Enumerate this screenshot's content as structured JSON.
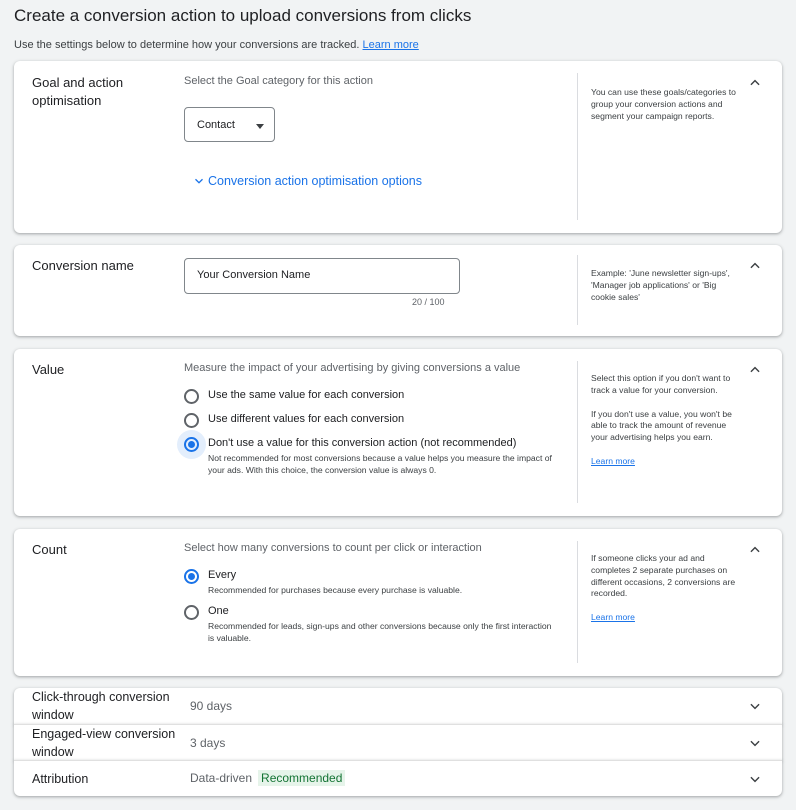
{
  "header": {
    "title": "Create a conversion action to upload conversions from clicks",
    "subtitle": "Use the settings below to determine how your conversions are tracked.",
    "learn_more": "Learn more"
  },
  "goal": {
    "title_line1": "Goal and action",
    "title_line2": "optimisation",
    "desc": "Select the Goal category for this action",
    "category_value": "Contact",
    "options_link": "Conversion action optimisation options",
    "help": "You can use these goals/categories to group your conversion actions and segment your campaign reports."
  },
  "conversion_name": {
    "title": "Conversion name",
    "value": "Your Conversion Name",
    "counter": "20 / 100",
    "help": "Example: 'June newsletter sign-ups', 'Manager job applications' or 'Big cookie sales'"
  },
  "value": {
    "title": "Value",
    "desc": "Measure the impact of your advertising by giving conversions a value",
    "options": [
      {
        "label": "Use the same value for each conversion",
        "sub": "",
        "checked": false
      },
      {
        "label": "Use different values for each conversion",
        "sub": "",
        "checked": false
      },
      {
        "label": "Don't use a value for this conversion action (not recommended)",
        "sub": "Not recommended for most conversions because a value helps you measure the impact of your ads. With this choice, the conversion value is always 0.",
        "checked": true
      }
    ],
    "help1": "Select this option if you don't want to track a value for your conversion.",
    "help2": "If you don't use a value, you won't be able to track the amount of revenue your advertising helps you earn.",
    "learn_more": "Learn more"
  },
  "count": {
    "title": "Count",
    "desc": "Select how many conversions to count per click or interaction",
    "options": [
      {
        "label": "Every",
        "sub": "Recommended for purchases because every purchase is valuable.",
        "checked": true
      },
      {
        "label": "One",
        "sub": "Recommended for leads, sign-ups and other conversions because only the first interaction is valuable.",
        "checked": false
      }
    ],
    "help": "If someone clicks your ad and completes 2 separate purchases on different occasions, 2 conversions are recorded.",
    "learn_more": "Learn more"
  },
  "click_through": {
    "title_line1": "Click-through conversion",
    "title_line2": "window",
    "value": "90 days"
  },
  "engaged_view": {
    "title_line1": "Engaged-view conversion",
    "title_line2": "window",
    "value": "3 days"
  },
  "attribution": {
    "title": "Attribution",
    "value": "Data-driven",
    "badge": "Recommended"
  },
  "colors": {
    "accent": "#1a73e8",
    "badge_bg": "#e6f4ea",
    "badge_text": "#137333",
    "page_bg": "#f1f3f4"
  }
}
